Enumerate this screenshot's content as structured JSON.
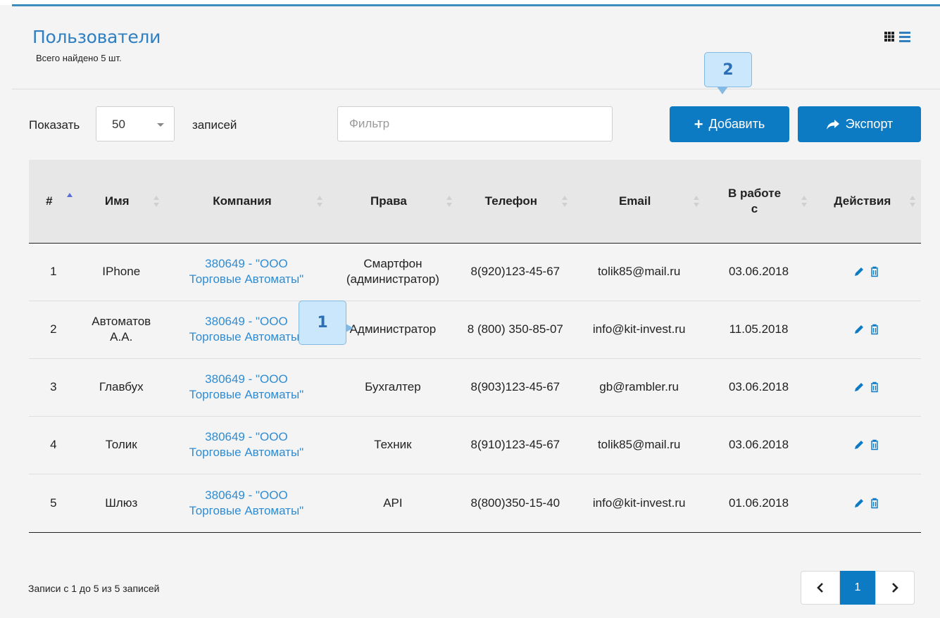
{
  "header": {
    "title": "Пользователи",
    "subtitle": "Всего найдено 5 шт."
  },
  "controls": {
    "show_label": "Показать",
    "page_size": "50",
    "records_label": "записей",
    "filter_placeholder": "Фильтр",
    "add_label": "Добавить",
    "export_label": "Экспорт"
  },
  "callouts": [
    "1",
    "2"
  ],
  "table": {
    "columns": [
      "#",
      "Имя",
      "Компания",
      "Права",
      "Телефон",
      "Email",
      "В работе с",
      "Действия"
    ],
    "rows": [
      {
        "num": "1",
        "name": "IPhone",
        "company_line1": "380649 - \"ООО",
        "company_line2": "Торговые Автоматы\"",
        "rights": "Смартфон (администратор)",
        "phone": "8(920)123-45-67",
        "email": "tolik85@mail.ru",
        "since": "03.06.2018"
      },
      {
        "num": "2",
        "name": "Автоматов А.А.",
        "company_line1": "380649 - \"ООО",
        "company_line2": "Торговые Автоматы\"",
        "rights": "Администратор",
        "phone": "8 (800) 350-85-07",
        "email": "info@kit-invest.ru",
        "since": "11.05.2018"
      },
      {
        "num": "3",
        "name": "Главбух",
        "company_line1": "380649 - \"ООО",
        "company_line2": "Торговые Автоматы\"",
        "rights": "Бухгалтер",
        "phone": "8(903)123-45-67",
        "email": "gb@rambler.ru",
        "since": "03.06.2018"
      },
      {
        "num": "4",
        "name": "Толик",
        "company_line1": "380649 - \"ООО",
        "company_line2": "Торговые Автоматы\"",
        "rights": "Техник",
        "phone": "8(910)123-45-67",
        "email": "tolik85@mail.ru",
        "since": "03.06.2018"
      },
      {
        "num": "5",
        "name": "Шлюз",
        "company_line1": "380649 - \"ООО",
        "company_line2": "Торговые Автоматы\"",
        "rights": "API",
        "phone": "8(800)350-15-40",
        "email": "info@kit-invest.ru",
        "since": "01.06.2018"
      }
    ]
  },
  "footer": {
    "info": "Записи с 1 до 5 из 5 записей",
    "current_page": "1"
  },
  "colors": {
    "accent": "#0d7ac4",
    "title": "#2f7fc1",
    "link": "#2f8cd3",
    "callout_bg": "#cbe7fb"
  },
  "icons": [
    "grid-view-icon",
    "list-view-icon",
    "plus-icon",
    "share-icon",
    "pencil-icon",
    "trash-icon",
    "chevron-left-icon",
    "chevron-right-icon"
  ]
}
